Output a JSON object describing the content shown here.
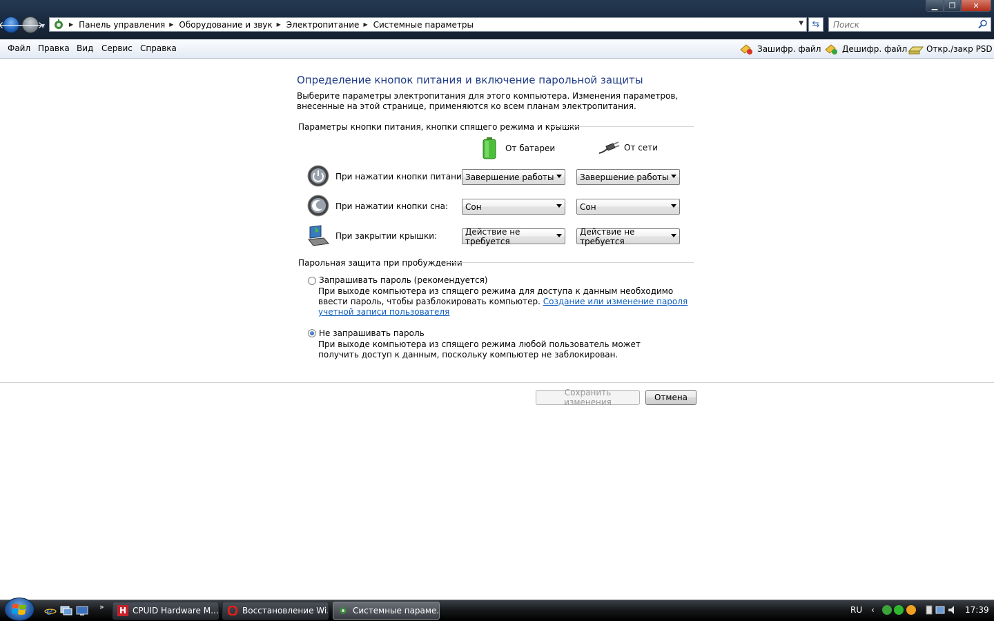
{
  "window": {
    "breadcrumb": [
      "Панель управления",
      "Оборудование и звук",
      "Электропитание",
      "Системные параметры"
    ],
    "search_placeholder": "Поиск"
  },
  "menu": {
    "items": [
      "Файл",
      "Правка",
      "Вид",
      "Сервис",
      "Справка"
    ],
    "tools": [
      "Зашифр. файл",
      "Дешифр. файл",
      "Откр./закр PSD"
    ]
  },
  "page": {
    "heading": "Определение кнопок питания и включение парольной защиты",
    "intro": "Выберите параметры электропитания для этого компьютера. Изменения параметров, внесенные на этой странице, применяются ко всем планам электропитания.",
    "buttons_section_title": "Параметры кнопки питания, кнопки спящего режима и крышки",
    "col_battery": "От батареи",
    "col_ac": "От сети",
    "rows": [
      {
        "label": "При нажатии кнопки питания:",
        "battery": "Завершение работы",
        "ac": "Завершение работы"
      },
      {
        "label": "При нажатии кнопки сна:",
        "battery": "Сон",
        "ac": "Сон"
      },
      {
        "label": "При закрытии крышки:",
        "battery": "Действие не требуется",
        "ac": "Действие не требуется"
      }
    ],
    "password_section_title": "Парольная защита при пробуждении",
    "opt1_label": "Запрашивать пароль (рекомендуется)",
    "opt1_desc": "При выходе компьютера из спящего режима для доступа к данным необходимо ввести пароль, чтобы разблокировать компьютер.",
    "opt1_link": "Создание или изменение пароля учетной записи пользователя",
    "opt2_label": "Не запрашивать пароль",
    "opt2_desc": "При выходе компьютера из спящего режима любой пользователь может получить доступ к данным, поскольку компьютер не заблокирован.",
    "save_label": "Сохранить изменения",
    "cancel_label": "Отмена"
  },
  "taskbar": {
    "tasks": [
      "CPUID Hardware M...",
      "Восстановление Wi...",
      "Системные параме..."
    ],
    "lang": "RU",
    "clock": "17:39"
  },
  "colors": {
    "heading": "#1e3a87",
    "link": "#0b5ebd"
  }
}
